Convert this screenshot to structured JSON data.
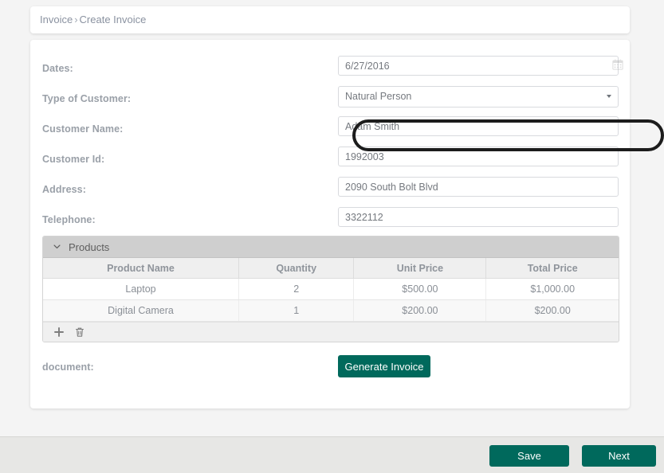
{
  "breadcrumb": {
    "root": "Invoice",
    "separator": "›",
    "current": "Create Invoice"
  },
  "form": {
    "fields": [
      {
        "label": "Dates:",
        "value": "6/27/2016",
        "type": "date",
        "icon": "calendar-icon",
        "name": "dates"
      },
      {
        "label": "Type of Customer:",
        "value": "Natural Person",
        "type": "select",
        "icon": "chevron-down-icon",
        "name": "type-of-customer"
      },
      {
        "label": "Customer Name:",
        "value": "Adam Smith",
        "type": "text",
        "name": "customer-name"
      },
      {
        "label": "Customer Id:",
        "value": "1992003",
        "type": "text",
        "name": "customer-id"
      },
      {
        "label": "Address:",
        "value": "2090 South Bolt Blvd",
        "type": "text",
        "name": "address"
      },
      {
        "label": "Telephone:",
        "value": "3322112",
        "type": "text",
        "name": "telephone"
      }
    ],
    "document_label": "document:",
    "generate_invoice_label": "Generate Invoice"
  },
  "products_panel": {
    "title": "Products",
    "collapse_icon": "chevron-down-icon",
    "columns": [
      "Product Name",
      "Quantity",
      "Unit Price",
      "Total Price"
    ],
    "rows": [
      {
        "product_name": "Laptop",
        "quantity": "2",
        "unit_price": "$500.00",
        "total_price": "$1,000.00"
      },
      {
        "product_name": "Digital Camera",
        "quantity": "1",
        "unit_price": "$200.00",
        "total_price": "$200.00"
      }
    ],
    "toolbar": {
      "add_icon": "plus-icon",
      "delete_icon": "trash-icon"
    }
  },
  "footer": {
    "save_label": "Save",
    "next_label": "Next"
  },
  "annotation": {
    "target": "type-of-customer-select",
    "shape": "oval",
    "color": "#1c1c1c"
  },
  "colors": {
    "accent_teal": "#00695c",
    "page_background": "#f4f4f4",
    "panel_header": "#cfcfcf",
    "footer_bar": "#e7e7e5"
  }
}
